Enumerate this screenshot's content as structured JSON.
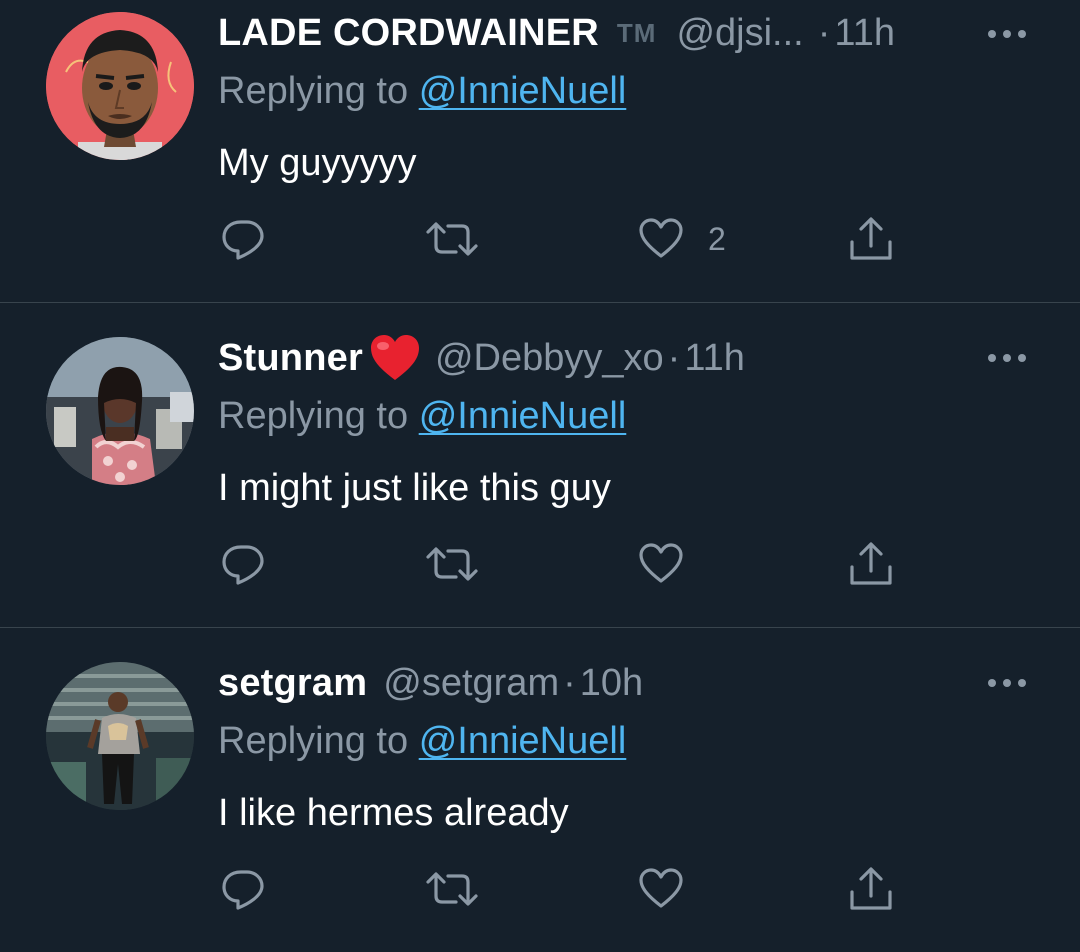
{
  "tweets": [
    {
      "name": "LADE CORDWAINER",
      "name_suffix": "TM",
      "handle": "@djsi...",
      "separator": "·",
      "time": "11h",
      "reply_prefix": "Replying to",
      "reply_to": "@InnieNuell",
      "text": "My guyyyyy",
      "like_count": "2",
      "avatar": "cartoon-man-avatar"
    },
    {
      "name": "Stunner",
      "name_emoji": "red-heart-emoji",
      "handle": "@Debbyy_xo",
      "separator": "·",
      "time": "11h",
      "reply_prefix": "Replying to",
      "reply_to": "@InnieNuell",
      "text": "I might just like this guy",
      "like_count": "",
      "avatar": "woman-photo-avatar"
    },
    {
      "name": "setgram",
      "handle": "@setgram",
      "separator": "·",
      "time": "10h",
      "reply_prefix": "Replying to",
      "reply_to": "@InnieNuell",
      "text": "I like hermes already",
      "like_count": "",
      "avatar": "man-photo-avatar"
    }
  ],
  "icons": {
    "reply": "reply-icon",
    "retweet": "retweet-icon",
    "like": "like-icon",
    "share": "share-icon",
    "more": "more-options-icon"
  },
  "colors": {
    "background": "#15202b",
    "divider": "#38444d",
    "secondary_text": "#8b98a5",
    "link": "#4fb5f0",
    "primary_text": "#ffffff"
  }
}
